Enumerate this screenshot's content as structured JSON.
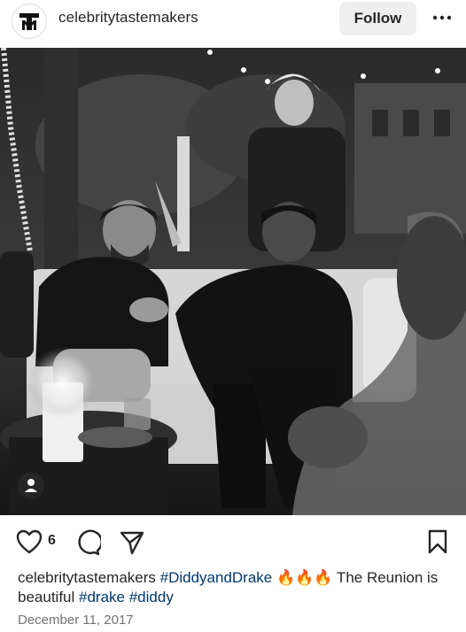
{
  "header": {
    "username": "celebritytastemakers",
    "follow_label": "Follow"
  },
  "post": {
    "likes": "6",
    "caption": {
      "username": "celebritytastemakers",
      "hashtag1": "#DiddyandDrake",
      "emoji": "🔥🔥🔥",
      "text1": " The Reunion is beautiful ",
      "hashtag2": "#drake",
      "hashtag3": "#diddy"
    },
    "date": "December 11, 2017"
  },
  "icons": {
    "avatar": "tm-logo-icon",
    "more": "more-horizontal-icon",
    "like": "heart-icon",
    "comment": "comment-icon",
    "share": "send-icon",
    "save": "bookmark-icon",
    "tag": "user-tag-icon"
  },
  "colors": {
    "text": "#262626",
    "hashtag": "#00376b",
    "muted": "#737373",
    "follow_bg": "#efefef"
  }
}
